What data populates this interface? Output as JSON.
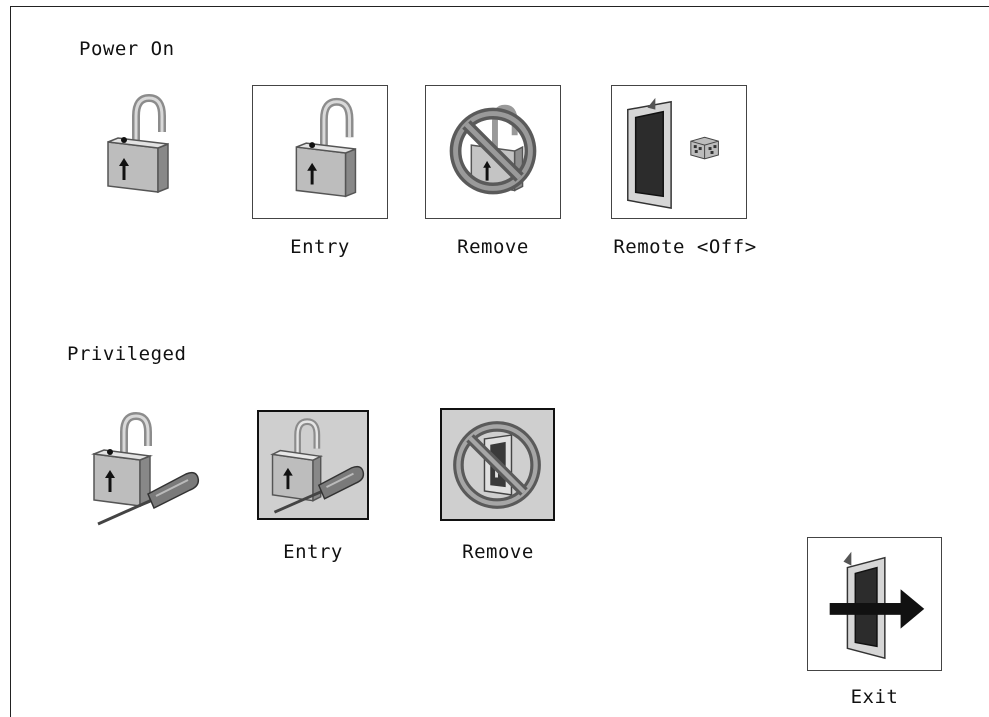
{
  "power_on": {
    "heading": "Power On",
    "entry_label": "Entry",
    "remove_label": "Remove",
    "remote_label": "Remote <Off>"
  },
  "privileged": {
    "heading": "Privileged",
    "entry_label": "Entry",
    "remove_label": "Remove"
  },
  "exit": {
    "label": "Exit"
  },
  "icons": {
    "power_on_status": "padlock-open-icon",
    "power_on_entry": "padlock-open-icon",
    "power_on_remove": "padlock-prohibited-icon",
    "power_on_remote": "door-remote-icon",
    "privileged_status": "padlock-screwdriver-icon",
    "privileged_entry": "padlock-screwdriver-icon",
    "privileged_remove": "door-prohibited-icon",
    "exit": "door-exit-arrow-icon"
  }
}
